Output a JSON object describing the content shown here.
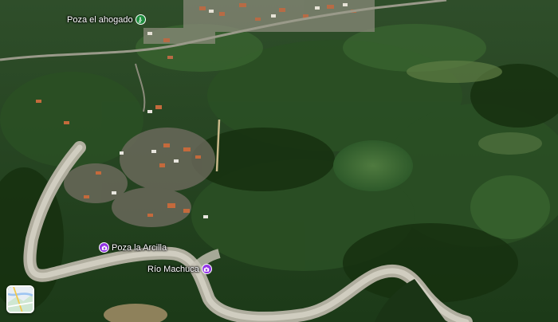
{
  "places": [
    {
      "id": "poza-el-ahogado",
      "label": "Poza el ahogado",
      "icon": "hiking-icon",
      "pin_color": "#1e8e3e"
    },
    {
      "id": "poza-la-arcilla",
      "label": "Poza la Arcilla",
      "icon": "camera-icon",
      "pin_color": "#9334e6"
    },
    {
      "id": "rio-machuca",
      "label": "Río Machuca",
      "icon": "camera-icon",
      "pin_color": "#9334e6"
    }
  ],
  "layer_toggle": {
    "icon": "map-layers-icon"
  }
}
